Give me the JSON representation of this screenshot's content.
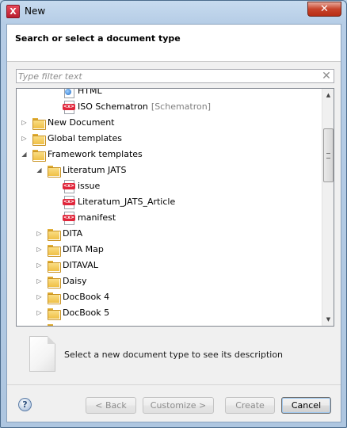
{
  "window": {
    "title": "New",
    "close_glyph": "✕",
    "app_icon": "oxygen-x-icon"
  },
  "header": {
    "title": "Search or select a document type"
  },
  "filter": {
    "placeholder": "Type filter text",
    "clear_glyph": "✕"
  },
  "tree": {
    "items": [
      {
        "label": "HTML",
        "tag": "",
        "icon": "html-file-icon",
        "level": 2,
        "arrow": ""
      },
      {
        "label": "ISO Schematron",
        "tag": "[Schematron]",
        "icon": "xml-file-icon",
        "level": 2,
        "arrow": ""
      },
      {
        "label": "New Document",
        "tag": "",
        "icon": "folder-icon",
        "level": 0,
        "arrow": "collapsed"
      },
      {
        "label": "Global templates",
        "tag": "",
        "icon": "folder-icon",
        "level": 0,
        "arrow": "collapsed"
      },
      {
        "label": "Framework templates",
        "tag": "",
        "icon": "folder-icon",
        "level": 0,
        "arrow": "expanded"
      },
      {
        "label": "Literatum JATS",
        "tag": "",
        "icon": "folder-icon",
        "level": 1,
        "arrow": "expanded"
      },
      {
        "label": "issue",
        "tag": "",
        "icon": "xml-file-icon",
        "level": 2,
        "arrow": ""
      },
      {
        "label": "Literatum_JATS_Article",
        "tag": "",
        "icon": "xml-file-icon",
        "level": 2,
        "arrow": ""
      },
      {
        "label": "manifest",
        "tag": "",
        "icon": "xml-file-icon",
        "level": 2,
        "arrow": ""
      },
      {
        "label": "DITA",
        "tag": "",
        "icon": "folder-icon",
        "level": 1,
        "arrow": "collapsed"
      },
      {
        "label": "DITA Map",
        "tag": "",
        "icon": "folder-icon",
        "level": 1,
        "arrow": "collapsed"
      },
      {
        "label": "DITAVAL",
        "tag": "",
        "icon": "folder-icon",
        "level": 1,
        "arrow": "collapsed"
      },
      {
        "label": "Daisy",
        "tag": "",
        "icon": "folder-icon",
        "level": 1,
        "arrow": "collapsed"
      },
      {
        "label": "DocBook 4",
        "tag": "",
        "icon": "folder-icon",
        "level": 1,
        "arrow": "collapsed"
      },
      {
        "label": "DocBook 5",
        "tag": "",
        "icon": "folder-icon",
        "level": 1,
        "arrow": "collapsed"
      },
      {
        "label": "",
        "tag": "",
        "icon": "folder-icon",
        "level": 1,
        "arrow": ""
      }
    ]
  },
  "description": {
    "text": "Select a new document type to see its description",
    "icon": "document-icon"
  },
  "footer": {
    "help_glyph": "?",
    "back_label": "< Back",
    "customize_label": "Customize >",
    "create_label": "Create",
    "cancel_label": "Cancel"
  }
}
